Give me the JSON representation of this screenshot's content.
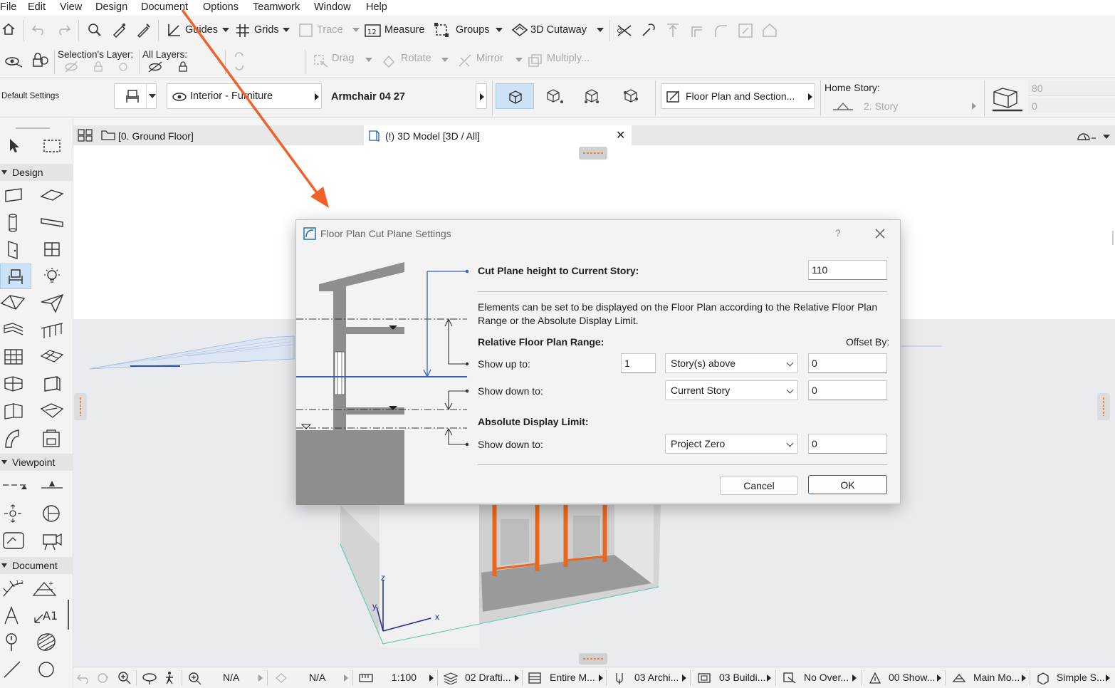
{
  "menu": [
    "File",
    "Edit",
    "View",
    "Design",
    "Document",
    "Options",
    "Teamwork",
    "Window",
    "Help"
  ],
  "toolbar1": {
    "guides": "Guides",
    "grids": "Grids",
    "trace": "Trace",
    "measure": "Measure",
    "groups": "Groups",
    "cutaway": "3D Cutaway"
  },
  "toolbar2": {
    "selection_layer": "Selection's Layer:",
    "all_layers": "All Layers:",
    "drag": "Drag",
    "rotate": "Rotate",
    "mirror": "Mirror",
    "multiply": "Multiply..."
  },
  "infobox": {
    "default_settings": "Default Settings",
    "layer": "Interior - Furniture",
    "object_name": "Armchair 04 27",
    "view_combo": "Floor Plan and Section...",
    "home_story_label": "Home Story:",
    "home_story_value": "2. Story",
    "value_top": "80",
    "value_bottom": "0"
  },
  "toolbox": {
    "design": "Design",
    "viewpoint": "Viewpoint",
    "document": "Document"
  },
  "tabs": {
    "floor": "[0. Ground Floor]",
    "model": "(!) 3D Model [3D / All]"
  },
  "axes": {
    "x": "x",
    "y": "y",
    "z": "z"
  },
  "statusbar": {
    "na1": "N/A",
    "na2": "N/A",
    "scale": "1:100",
    "layer_combo": "02 Drafti...",
    "model": "Entire M...",
    "pen": "03 Archi...",
    "building": "03 Buildi...",
    "override": "No Over...",
    "renovation": "00 Show...",
    "model_view": "Main Mo...",
    "structure": "Simple S..."
  },
  "dialog": {
    "title": "Floor Plan Cut Plane Settings",
    "help": "?",
    "cut_label": "Cut Plane height to Current Story:",
    "cut_value": "110",
    "description": "Elements can be set to be displayed on the Floor Plan according to the Relative Floor Plan Range or the Absolute Display Limit.",
    "relative_heading": "Relative Floor Plan Range:",
    "offset_by": "Offset By:",
    "show_up_to": "Show up to:",
    "up_count": "1",
    "up_select": "Story(s) above",
    "up_offset": "0",
    "show_down_to": "Show down to:",
    "down_select": "Current Story",
    "down_offset": "0",
    "absolute_heading": "Absolute Display Limit:",
    "abs_show_down_to": "Show down to:",
    "abs_select": "Project Zero",
    "abs_offset": "0",
    "cancel": "Cancel",
    "ok": "OK"
  },
  "colors": {
    "accent": "#0067c0",
    "annotation_arrow": "#f0602a",
    "section_gray": "#8e8e8e",
    "cut_line": "#2e63c4"
  }
}
